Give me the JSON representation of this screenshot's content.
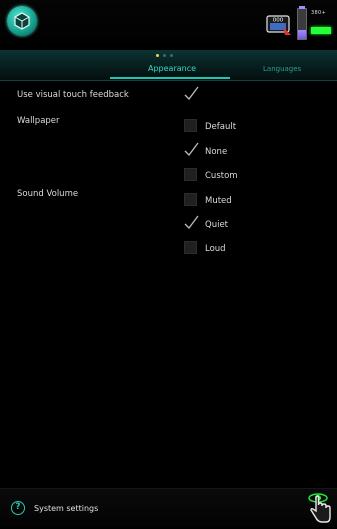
{
  "header": {
    "device_icon_text": "000",
    "status_small_text": "380+",
    "battery_level": 0.3
  },
  "tabs": {
    "active": "Appearance",
    "items": [
      {
        "label": "Appearance",
        "active": true
      },
      {
        "label": "Languages",
        "active": false
      }
    ],
    "page_dots": 3,
    "active_dot": 0
  },
  "settings": {
    "visual_touch_feedback": {
      "label": "Use visual touch feedback",
      "checked": true
    },
    "wallpaper": {
      "label": "Wallpaper",
      "options": [
        {
          "label": "Default",
          "checked": false
        },
        {
          "label": "None",
          "checked": true
        },
        {
          "label": "Custom",
          "checked": false
        }
      ]
    },
    "sound_volume": {
      "label": "Sound Volume",
      "options": [
        {
          "label": "Muted",
          "checked": false
        },
        {
          "label": "Quiet",
          "checked": true
        },
        {
          "label": "Loud",
          "checked": false
        }
      ]
    }
  },
  "footer": {
    "title": "System settings",
    "help_icon_glyph": "?"
  },
  "colors": {
    "accent": "#1fc7b2",
    "tab_bg": "#0b3433",
    "signal": "#25ff3a",
    "battery": "#8a74f0",
    "background": "#000000"
  },
  "icons": {
    "app_logo": "gear-cube-icon",
    "device": "device-icon",
    "battery": "battery-icon",
    "signal": "signal-icon",
    "help": "help-icon",
    "touch": "touch-hand-icon",
    "check": "checkmark-icon"
  }
}
